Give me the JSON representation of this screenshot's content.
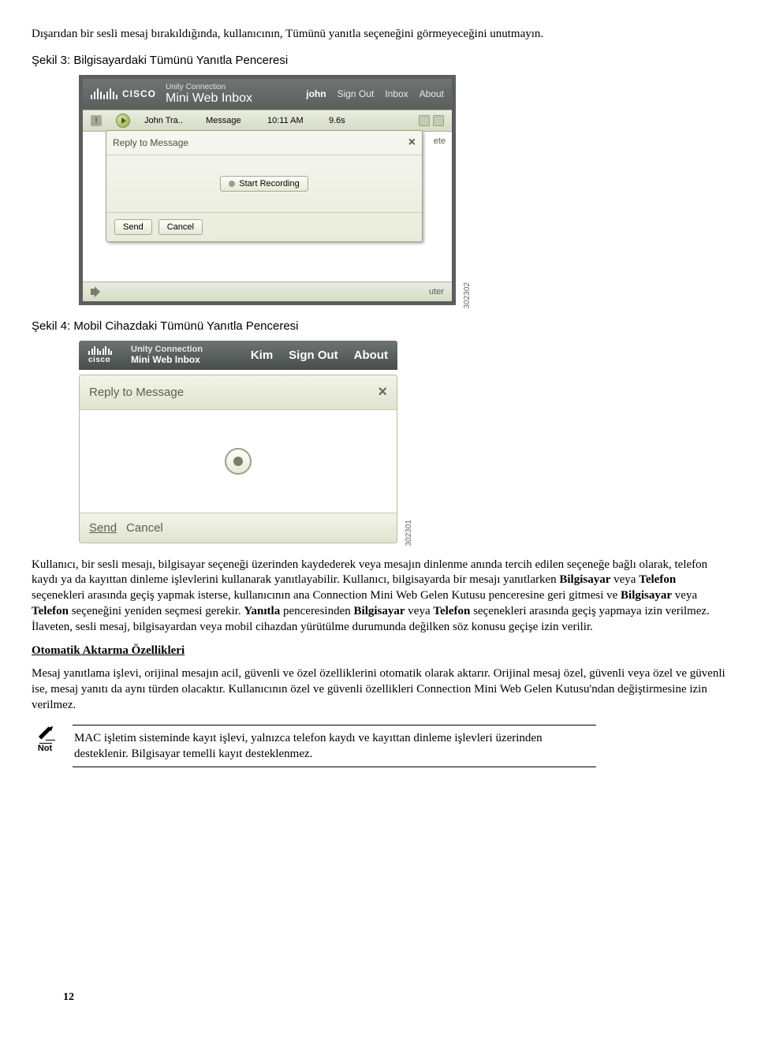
{
  "intro_line": "Dışarıdan bir sesli mesaj bırakıldığında, kullanıcının, Tümünü yanıtla seçeneğini görmeyeceğini unutmayın.",
  "fig3": {
    "heading": "Şekil 3: Bilgisayardaki Tümünü Yanıtla Penceresi",
    "id_tag": "302302",
    "header": {
      "brand": "CISCO",
      "title_top": "Unity Connection",
      "title_main": "Mini Web Inbox",
      "user": "john",
      "links": [
        "Sign Out",
        "Inbox",
        "About"
      ]
    },
    "row": {
      "from": "John Tra..",
      "subject": "Message",
      "time": "10:11 AM",
      "duration": "9.6s"
    },
    "popup": {
      "title": "Reply to Message",
      "start_btn": "Start Recording",
      "send": "Send",
      "cancel": "Cancel"
    },
    "bottom": {
      "ete": "ete",
      "uter": "uter"
    }
  },
  "fig4": {
    "heading": "Şekil 4: Mobil Cihazdaki Tümünü Yanıtla Penceresi",
    "id_tag": "302301",
    "header": {
      "brand": "cisco",
      "title_top": "Unity Connection",
      "title_main": "Mini Web Inbox",
      "user": "Kim",
      "links": [
        "Sign Out",
        "About"
      ]
    },
    "panel": {
      "title": "Reply to Message",
      "send": "Send",
      "cancel": "Cancel"
    }
  },
  "body_para": "Kullanıcı, bir sesli mesajı, bilgisayar seçeneği üzerinden kaydederek veya mesajın dinlenme anında tercih edilen seçeneğe bağlı olarak, telefon kaydı ya da kayıttan dinleme işlevlerini kullanarak yanıtlayabilir. Kullanıcı, bilgisayarda bir mesajı yanıtlarken Bilgisayar veya Telefon seçenekleri arasında geçiş yapmak isterse, kullanıcının ana Connection Mini Web Gelen Kutusu penceresine geri gitmesi ve Bilgisayar veya Telefon seçeneğini yeniden seçmesi gerekir. Yanıtla penceresinden Bilgisayar veya Telefon seçenekleri arasında geçiş yapmaya izin verilmez. İlaveten, sesli mesaj, bilgisayardan veya mobil cihazdan yürütülme durumunda değilken söz konusu geçişe izin verilir.",
  "auto_head": "Otomatik Aktarma Özellikleri",
  "auto_para": "Mesaj yanıtlama işlevi, orijinal mesajın acil, güvenli ve özel özelliklerini otomatik olarak aktarır. Orijinal mesaj özel, güvenli veya özel ve güvenli ise, mesaj yanıtı da aynı türden olacaktır. Kullanıcının özel ve güvenli özellikleri Connection Mini Web Gelen Kutusu'ndan değiştirmesine izin verilmez.",
  "note_label": "Not",
  "note_text": "MAC işletim sisteminde kayıt işlevi, yalnızca telefon kaydı ve kayıttan dinleme işlevleri üzerinden desteklenir. Bilgisayar temelli kayıt desteklenmez.",
  "page_number": "12"
}
